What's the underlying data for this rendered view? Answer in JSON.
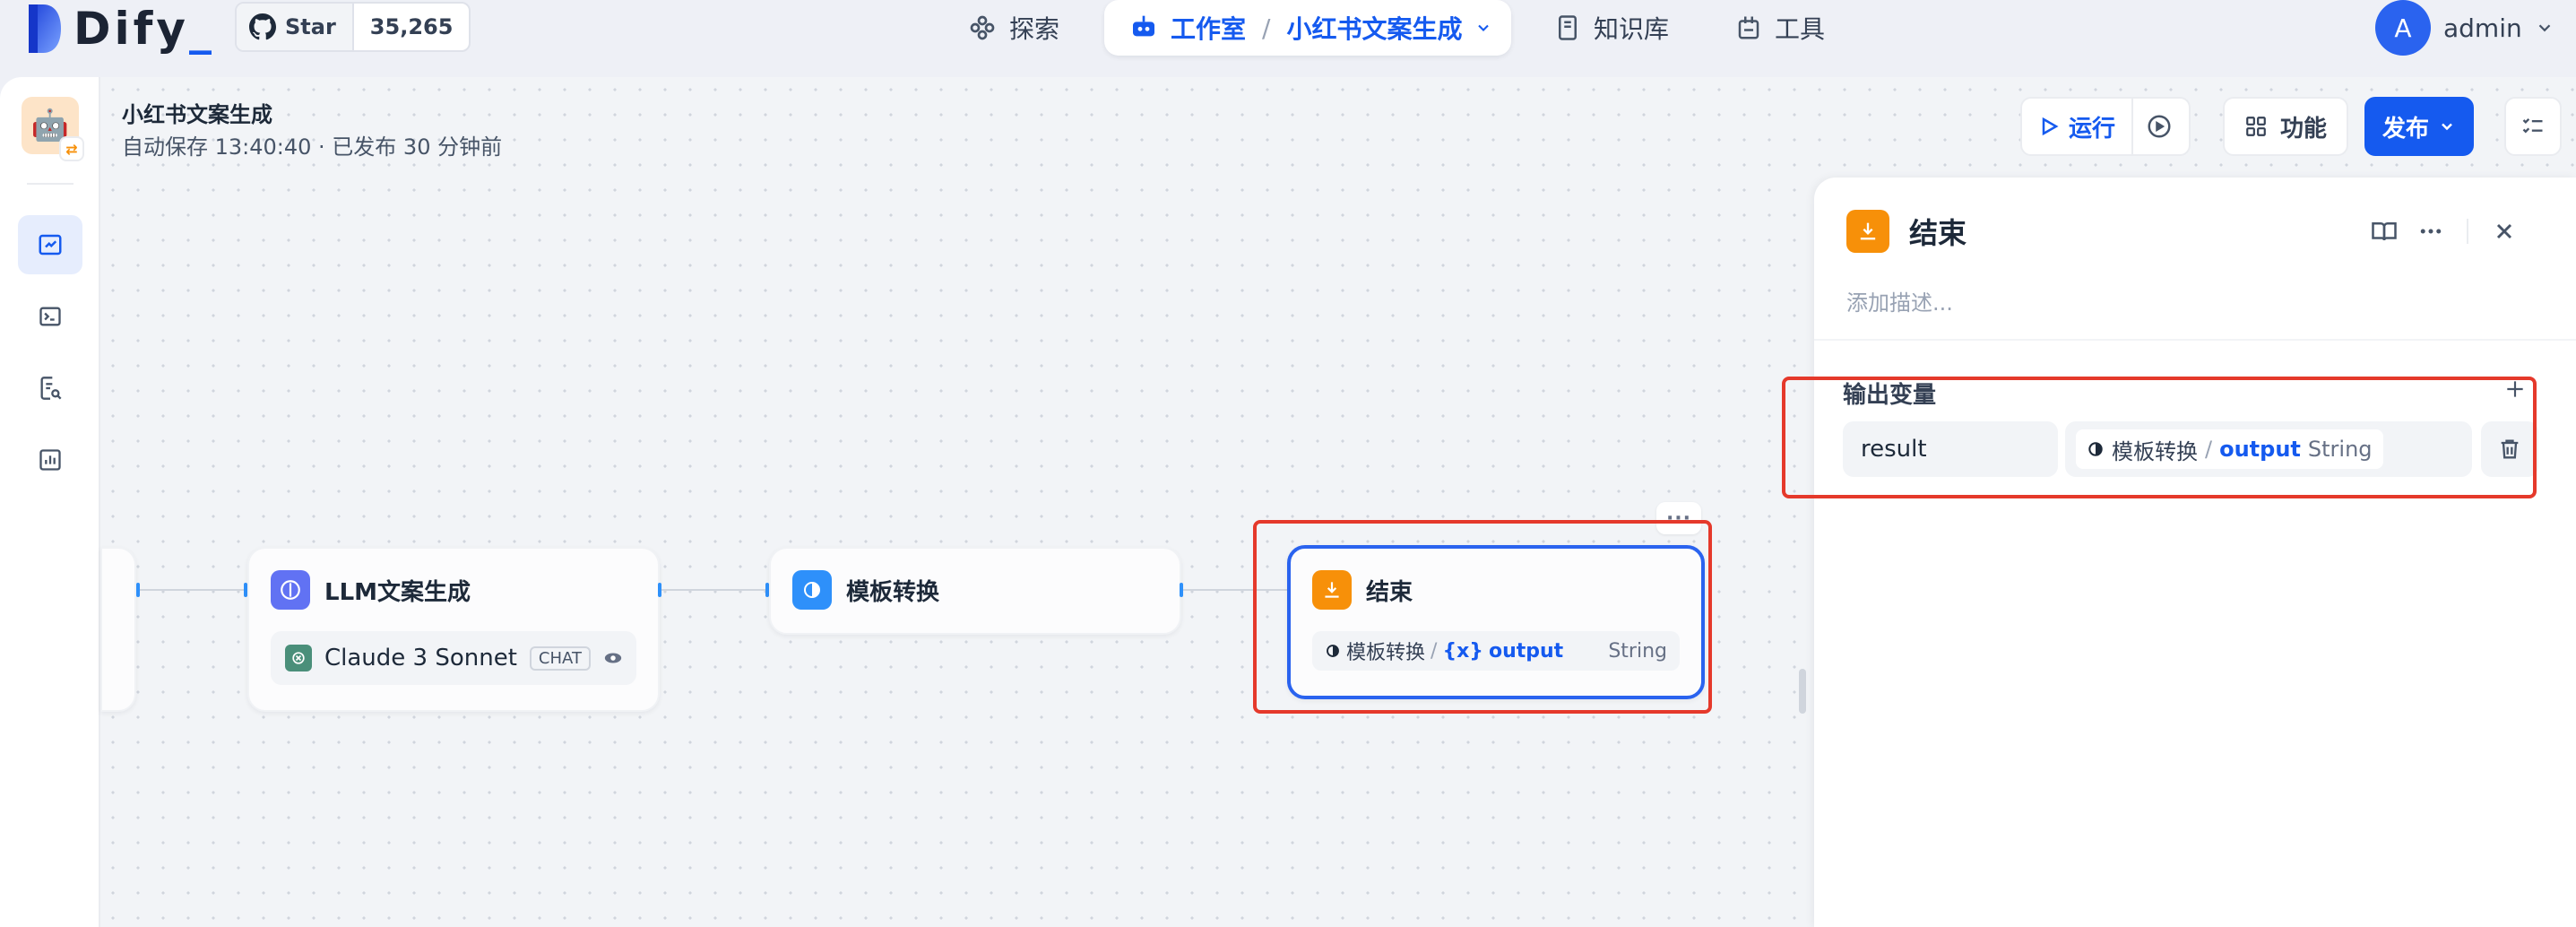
{
  "brand": {
    "name": "Dify",
    "accent": "#155aef"
  },
  "github": {
    "star_label": "Star",
    "star_count": "35,265"
  },
  "nav": {
    "explore": "探索",
    "studio": "工作室",
    "current_app": "小红书文案生成",
    "knowledge": "知识库",
    "tools": "工具"
  },
  "user": {
    "initial": "A",
    "name": "admin"
  },
  "app": {
    "title": "小红书文案生成",
    "status": "自动保存 13:40:40 · 已发布 30 分钟前"
  },
  "toolbar": {
    "run_label": "运行",
    "features_label": "功能",
    "publish_label": "发布"
  },
  "nodes": {
    "llm": {
      "title": "LLM文案生成",
      "model": "Claude 3 Sonnet",
      "mode_tag": "CHAT"
    },
    "template": {
      "title": "模板转换"
    },
    "end": {
      "title": "结束",
      "var_node": "模板转换",
      "var_name": "output",
      "var_type": "String"
    }
  },
  "panel": {
    "title": "结束",
    "description_placeholder": "添加描述...",
    "output_section_title": "输出变量",
    "outputs": [
      {
        "name": "result",
        "source_node": "模板转换",
        "source_var": "output",
        "type": "String"
      }
    ]
  },
  "colors": {
    "llm_icon": "#6172f3",
    "template_icon": "#2e90fa",
    "end_icon": "#f79009",
    "selected_border": "#2a63ef",
    "highlight_box": "#e5392b"
  }
}
